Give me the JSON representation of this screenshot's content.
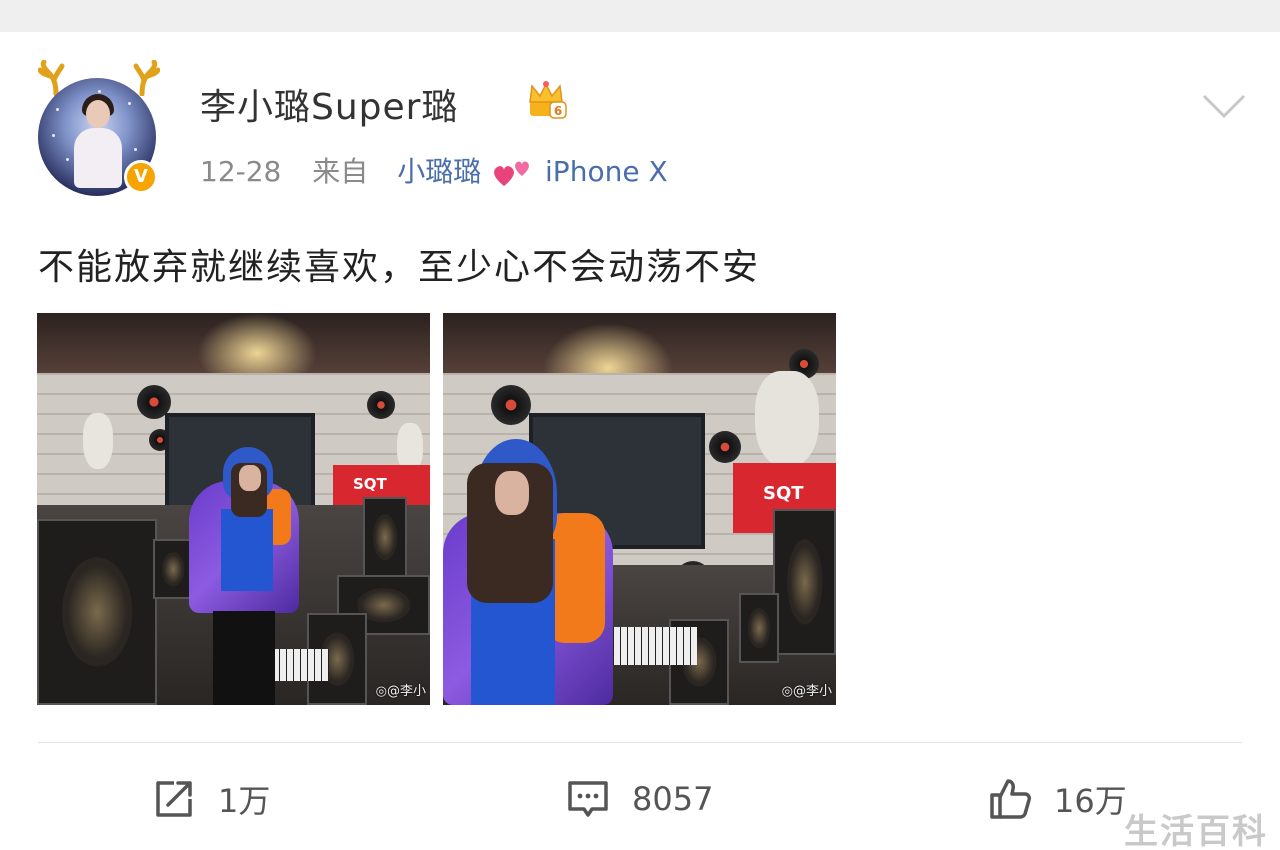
{
  "post": {
    "username": "李小璐Super璐",
    "time": "12-28",
    "from_label": "来自",
    "source_prefix": "小璐璐",
    "source_device": "iPhone X",
    "text": "不能放弃就继续喜欢，至少心不会动荡不安",
    "verified_badge": "V",
    "photo_watermarks": [
      "◎@李小",
      "◎@李小"
    ]
  },
  "actions": {
    "share_count": "1万",
    "comment_count": "8057",
    "like_count": "16万"
  },
  "overlay": {
    "site_watermark": "生活百科"
  },
  "colors": {
    "link": "#4a6ea9",
    "verified": "#f7a300",
    "text": "#222222",
    "meta": "#8a8a8a"
  },
  "icons": [
    "antler-icon",
    "crown-vip-icon",
    "chevron-down-icon",
    "hearts-icon",
    "share-icon",
    "comment-icon",
    "like-icon"
  ]
}
